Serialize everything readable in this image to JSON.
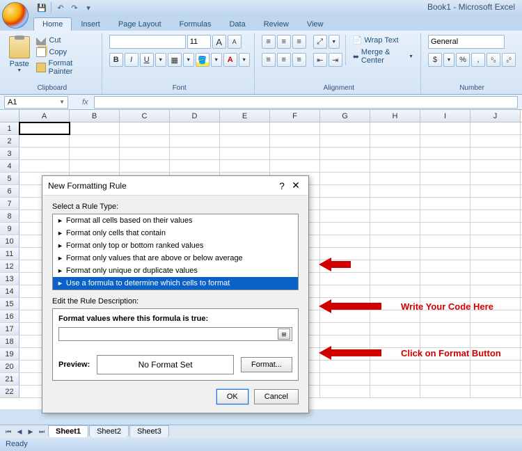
{
  "app_title": "Book1 - Microsoft Excel",
  "qat": {
    "save": "💾",
    "undo": "↶",
    "redo": "↷"
  },
  "tabs": [
    "Home",
    "Insert",
    "Page Layout",
    "Formulas",
    "Data",
    "Review",
    "View"
  ],
  "active_tab": "Home",
  "ribbon": {
    "clipboard": {
      "group": "Clipboard",
      "paste": "Paste",
      "cut": "Cut",
      "copy": "Copy",
      "painter": "Format Painter"
    },
    "font": {
      "group": "Font",
      "name": "",
      "size": "11",
      "growA": "A",
      "shrinkA": "A",
      "bold": "B",
      "italic": "I",
      "underline": "U"
    },
    "alignment": {
      "group": "Alignment",
      "wrap": "Wrap Text",
      "merge": "Merge & Center"
    },
    "number": {
      "group": "Number",
      "format": "General",
      "currency": "$",
      "percent": "%",
      "comma": ",",
      "inc": ".0",
      "dec": ".00"
    }
  },
  "namebox": "A1",
  "fx_label": "fx",
  "columns": [
    "A",
    "B",
    "C",
    "D",
    "E",
    "F",
    "G",
    "H",
    "I",
    "J"
  ],
  "row_count": 22,
  "selected_cell": "A1",
  "dialog": {
    "title": "New Formatting Rule",
    "help": "?",
    "select_label": "Select a Rule Type:",
    "rules": [
      "Format all cells based on their values",
      "Format only cells that contain",
      "Format only top or bottom ranked values",
      "Format only values that are above or below average",
      "Format only unique or duplicate values",
      "Use a formula to determine which cells to format"
    ],
    "selected_rule_index": 5,
    "edit_label": "Edit the Rule Description:",
    "formula_label": "Format values where this formula is true:",
    "formula_value": "",
    "preview_label": "Preview:",
    "preview_text": "No Format Set",
    "format_btn": "Format...",
    "ok": "OK",
    "cancel": "Cancel"
  },
  "annotations": {
    "a1": "Write Your Code Here",
    "a2": "Click on Format Button"
  },
  "sheets": [
    "Sheet1",
    "Sheet2",
    "Sheet3"
  ],
  "active_sheet": "Sheet1",
  "status": "Ready"
}
